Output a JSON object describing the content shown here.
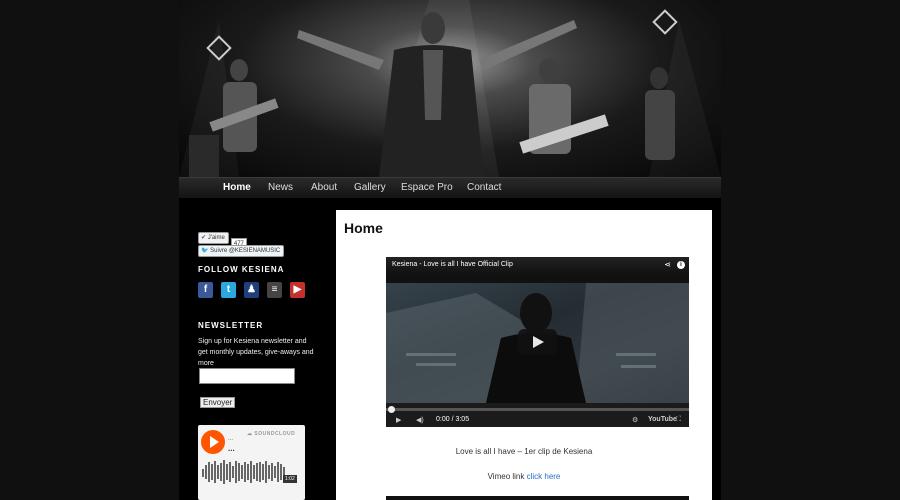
{
  "nav": {
    "items": [
      "Home",
      "News",
      "About",
      "Gallery",
      "Espace Pro",
      "Contact"
    ],
    "active": "Home"
  },
  "sidebar": {
    "fb_like": "J'aime",
    "fb_count": "477",
    "twitter_follow": "Suivre @KESIENAMUSIC",
    "follow_title": "FOLLOW KESIENA",
    "social_icons": [
      "facebook-icon",
      "twitter-icon",
      "myspace-icon",
      "deezer-icon",
      "youtube-icon"
    ],
    "newsletter_title": "NEWSLETTER",
    "newsletter_text": "Sign up for Kesiena newsletter and get monthly updates, give-aways and more",
    "newsletter_button": "Envoyer",
    "soundcloud": {
      "brand": "SOUNDCLOUD",
      "artist": "...",
      "track": "...",
      "time": "1:02"
    }
  },
  "main": {
    "title": "Home",
    "video": {
      "title": "Kesiena - Love is all I have Official Clip",
      "time": "0:00 / 3:05",
      "brand": "YouTube"
    },
    "caption": "Love is all I have – 1er clip de Kesiena",
    "vimeo_prefix": "Vimeo link ",
    "vimeo_link": "click here"
  },
  "colors": {
    "background": "#111111",
    "page": "#000000",
    "content": "#ffffff",
    "soundcloud": "#ff5500",
    "link": "#2a6fc0"
  }
}
